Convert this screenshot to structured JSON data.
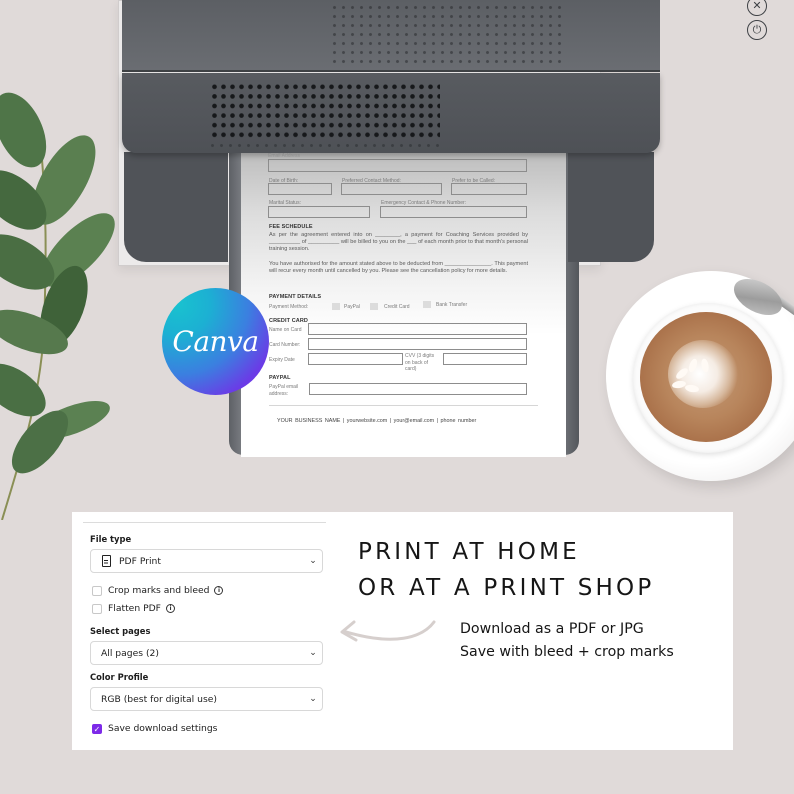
{
  "printer": {
    "buttons": [
      {
        "name": "cancel",
        "glyph": "✕"
      },
      {
        "name": "power",
        "glyph": "⏻"
      }
    ]
  },
  "paper": {
    "fields": {
      "email": "Email Address",
      "dob": "Date of Birth:",
      "contact_method": "Preferred Contact Method:",
      "prefer_called": "Prefer to be Called:",
      "marital": "Marital Status:",
      "emergency": "Emergency Contact & Phone Number:"
    },
    "fee_schedule": {
      "heading": "FEE SCHEDULE",
      "para1": "As per the agreement entered into on ________, a payment for Coaching Services provided by __________ of __________ will be billed to you on the ___ of each month prior to that month's personal training session.",
      "para2": "You have authorised for the amount stated above to be deducted from _______________. This payment will recur every month until cancelled by you. Please see the cancellation policy for more details."
    },
    "payment": {
      "heading": "PAYMENT DETAILS",
      "method_label": "Payment Method:",
      "methods": [
        "PayPal",
        "Credit Card",
        "Bank Transfer"
      ]
    },
    "credit_card": {
      "heading": "CREDIT CARD",
      "name_on_card": "Name on Card",
      "card_number": "Card Number:",
      "expiry": "Expiry Date",
      "cvv": "CVV (3 digits on back of card)"
    },
    "paypal": {
      "heading": "PAYPAL",
      "email": "PayPal email address:"
    },
    "footer": "YOUR BUSINESS NAME   |   yourwebsite.com   |   your@email.com   |   phone number"
  },
  "logo": {
    "text": "Canva"
  },
  "export_panel": {
    "file_type": {
      "label": "File type",
      "value": "PDF Print",
      "icon": "document-icon"
    },
    "options": [
      {
        "label": "Crop marks and bleed",
        "checked": false,
        "info": true
      },
      {
        "label": "Flatten PDF",
        "checked": false,
        "info": true
      }
    ],
    "select_pages": {
      "label": "Select pages",
      "value": "All pages (2)"
    },
    "color_profile": {
      "label": "Color Profile",
      "value": "RGB (best for digital use)"
    },
    "save_settings": {
      "label": "Save download settings",
      "checked": true
    },
    "accent_color": "#7d2ae8"
  },
  "promo": {
    "headline_line1": "PRINT AT HOME",
    "headline_line2": "OR AT A PRINT SHOP",
    "sub_line1": "Download as a PDF or JPG",
    "sub_line2": "Save with bleed + crop marks"
  },
  "icons": {
    "chevron": "⌄",
    "info": "i",
    "check": "✓"
  }
}
